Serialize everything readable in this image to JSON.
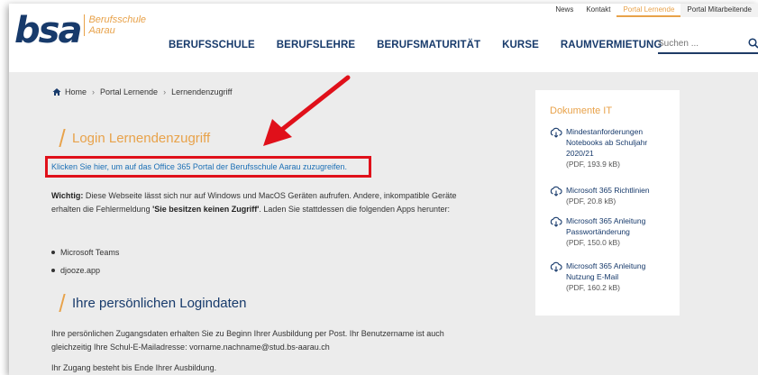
{
  "header": {
    "logo_text": "bsa",
    "logo_sub_1": "Berufsschule",
    "logo_sub_2": "Aarau",
    "top_nav": [
      "News",
      "Kontakt",
      "Portal Lernende",
      "Portal Mitarbeitende"
    ],
    "main_nav": [
      "BERUFSSCHULE",
      "BERUFSLEHRE",
      "BERUFSMATURITÄT",
      "KURSE",
      "RAUMVERMIETUNG"
    ],
    "search_placeholder": "Suchen ..."
  },
  "breadcrumb": [
    "Home",
    "Portal Lernende",
    "Lernendenzugriff"
  ],
  "login_section": {
    "title": "Login Lernendenzugriff",
    "office_link": "Klicken Sie hier, um auf das Office 365 Portal der Berufsschule Aarau zuzugreifen.",
    "note_bold": "Wichtig:",
    "note_text_1": " Diese Webseite lässt sich nur auf Windows und MacOS Geräten aufrufen. Andere, inkompatible Geräte erhalten die Fehlermeldung ",
    "note_error": "'Sie besitzen keinen Zugriff'",
    "note_text_2": ". Laden Sie stattdessen die folgenden Apps herunter:",
    "apps": [
      "Microsoft Teams",
      "djooze.app"
    ]
  },
  "credentials_section": {
    "title": "Ihre persönlichen Logindaten",
    "text": "Ihre persönlichen Zugangsdaten erhalten Sie zu Beginn Ihrer Ausbildung per Post. Ihr Benutzername ist auch gleichzeitig Ihre Schul-E-Mailadresse: vorname.nachname@stud.bs-aarau.ch",
    "cutoff_line": "Ihr Zugang besteht bis Ende Ihrer Ausbildung."
  },
  "sidebar": {
    "title": "Dokumente IT",
    "docs": [
      {
        "title": "Mindestanforderungen Notebooks ab Schuljahr 2020/21",
        "meta": "(PDF, 193.9 kB)"
      },
      {
        "title": "Microsoft 365 Richtlinien",
        "meta": "(PDF, 20.8 kB)"
      },
      {
        "title": "Microsoft 365 Anleitung Passwortänderung",
        "meta": "(PDF, 150.0 kB)"
      },
      {
        "title": "Microsoft 365 Anleitung Nutzung E-Mail",
        "meta": "(PDF, 160.2 kB)"
      }
    ]
  },
  "colors": {
    "brand_blue": "#173a6b",
    "accent_orange": "#e8a24a",
    "highlight_red": "#e0101a",
    "link_blue": "#1b6fb5"
  }
}
